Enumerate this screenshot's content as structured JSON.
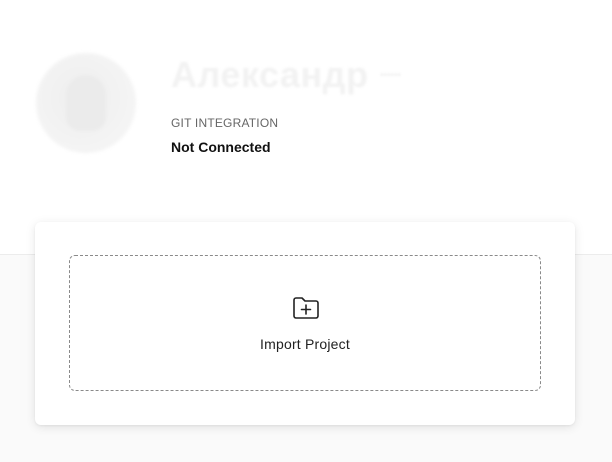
{
  "profile": {
    "name": "Александр",
    "handle": "••••••",
    "git_integration_label": "GIT INTEGRATION",
    "git_integration_status": "Not Connected"
  },
  "import": {
    "label": "Import Project",
    "icon": "folder-plus-icon"
  }
}
